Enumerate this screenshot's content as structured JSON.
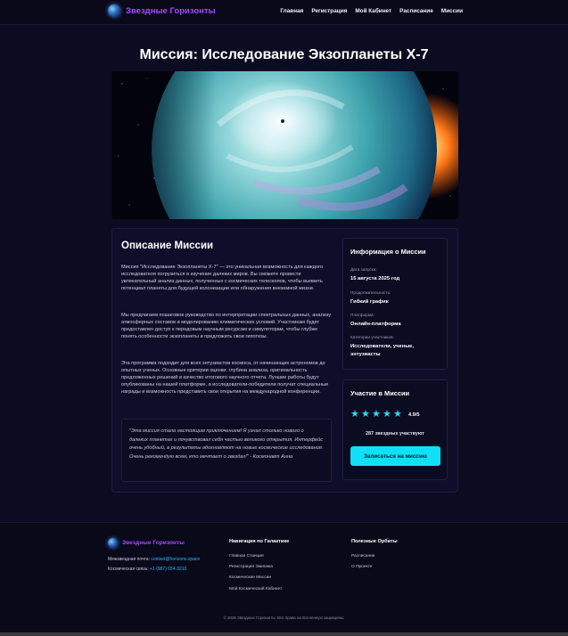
{
  "header": {
    "logo_text": "Звездные Горизонты",
    "nav": [
      "Главная",
      "Регистрация",
      "Мой Кабинет",
      "Расписание",
      "Миссии"
    ]
  },
  "page": {
    "title": "Миссия: Исследование Экзопланеты X-7"
  },
  "mission": {
    "section_title": "Описание Миссии",
    "paragraphs": [
      "Миссия \"Исследование Экзопланеты X-7\" — это уникальная возможность для каждого исследователя погрузиться в изучение далеких миров. Вы сможете провести увлекательный анализ данных, полученных с космических телескопов, чтобы выявить потенциал планеты для будущей колонизации или обнаружения внеземной жизни.",
      "Мы предлагаем пошаговое руководство по интерпретации спектральных данных, анализу атмосферных составов и моделированию климатических условий. Участникам будет предоставлен доступ к передовым научным ресурсам и симуляторам, чтобы глубже понять особенности экзопланеты и предложить свои гипотезы.",
      "Эта программа подходит для всех энтузиастов космоса, от начинающих астрономов до опытных ученых. Основные критерии оценки: глубина анализа, оригинальность предложенных решений и качество итогового научного отчета. Лучшие работы будут опубликованы на нашей платформе, а исследователи-победители получат специальные награды и возможность представить свои открытия на международной конференции."
    ],
    "quote": "\"Эта миссия стала настоящим приключением! Я узнал столько нового о далеких планетах и почувствовал себя частью великого открытия. Интерфейс очень удобный, а результаты вдохновляют на новые космические исследования. Очень рекомендую всем, кто мечтает о звездах!\" - Космонавт Анна"
  },
  "info": {
    "title": "Информация о Миссии",
    "items": [
      {
        "label": "Дата запуска:",
        "value": "15 августа 2025 год"
      },
      {
        "label": "Продолжительность:",
        "value": "Гибкий график"
      },
      {
        "label": "Платформа:",
        "value": "Онлайн-платформа"
      },
      {
        "label": "Категории участников:",
        "value": "Исследователи, ученые, энтузиасты"
      }
    ]
  },
  "participation": {
    "title": "Участие в Миссии",
    "stars": 5,
    "rating": "4.9/5",
    "participants": "287 звездных участвуют",
    "button": "Записаться на миссию"
  },
  "footer": {
    "logo_text": "Звездные Горизонты",
    "email_label": "Межзвездная почта:",
    "email": "contact@horizons.space",
    "phone_label": "Космическая связь:",
    "phone": "+1 (987) 654-3210",
    "nav_title": "Навигация по Галактике",
    "nav_links": [
      "Главная Станция",
      "Регистрация Экипажа",
      "Космические Миссии",
      "Мой Космический Кабинет"
    ],
    "orbits_title": "Полезные Орбиты",
    "orbits_links": [
      "Расписание",
      "О Проекте"
    ],
    "copyright": "© 2025 Звездные Горизонты. Все права на Вселенную защищены."
  },
  "colors": {
    "background": "#0b0b22",
    "accent_purple": "#a24cff",
    "accent_cyan": "#10e0f6",
    "link_blue": "#2fb8ff"
  }
}
